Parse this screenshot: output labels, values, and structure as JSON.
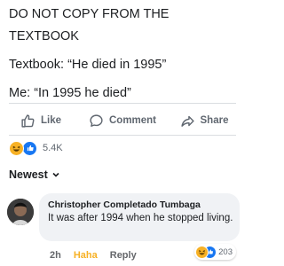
{
  "post": {
    "lines": [
      "DO NOT COPY FROM THE",
      "TEXTBOOK",
      "Textbook: “He died in 1995”",
      "Me: “In 1995 he died”"
    ]
  },
  "actions": {
    "like": "Like",
    "comment": "Comment",
    "share": "Share"
  },
  "reactions": {
    "count": "5.4K"
  },
  "sort": {
    "label": "Newest"
  },
  "comment": {
    "author": "Christopher Completado Tumbaga",
    "text": "It was after 1994 when he stopped living.",
    "time": "2h",
    "haha_label": "Haha",
    "reply_label": "Reply",
    "reaction_count": "203"
  },
  "colors": {
    "haha": "#f7b125",
    "like_blue": "#1877f2",
    "meta_gray": "#65676b"
  }
}
